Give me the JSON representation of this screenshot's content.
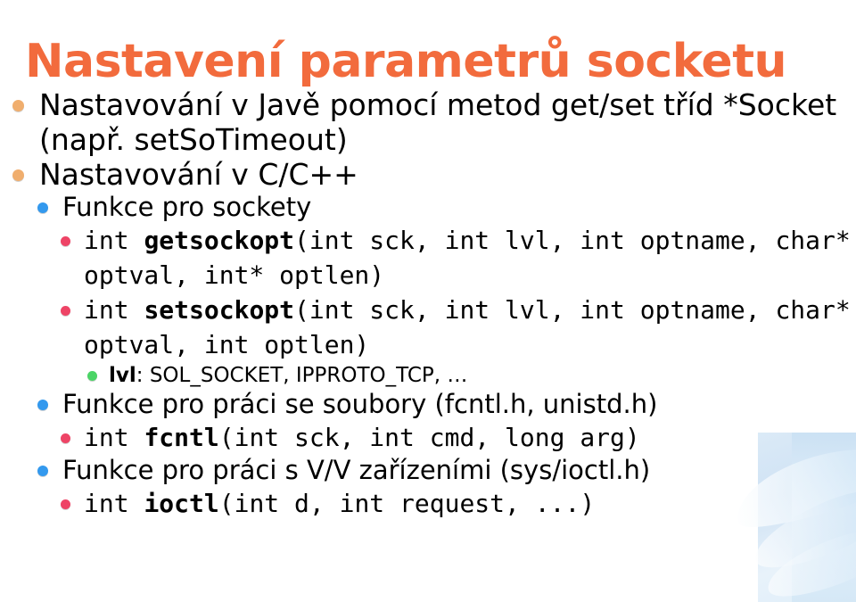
{
  "slide": {
    "title": "Nastavení parametrů socketu",
    "title_color": "#F26B3D",
    "background_color": "#FFFFFF",
    "text_color": "#000000"
  },
  "bullet_colors": {
    "level1": "#F0AE6E",
    "level2": "#3399EE",
    "level3": "#EE4466",
    "level4": "#4BD466"
  },
  "outline": {
    "item1": {
      "level": 1,
      "text": "Nastavování v Javě pomocí metod get/set tříd *Socket (např. setSoTimeout)"
    },
    "item2": {
      "level": 1,
      "text": "Nastavování v C/C++"
    },
    "item3": {
      "level": 2,
      "text": "Funkce pro sockety"
    },
    "item4": {
      "level": 3,
      "prefix": "int ",
      "name": "getsockopt",
      "suffix": "(int sck, int lvl, int optname, char* optval, int* optlen)"
    },
    "item5": {
      "level": 3,
      "prefix": "int ",
      "name": "setsockopt",
      "suffix": "(int sck, int lvl, int optname, char* optval, int optlen)"
    },
    "item6": {
      "level": 4,
      "name": "lvl",
      "text": ": SOL_SOCKET, IPPROTO_TCP, …"
    },
    "item7": {
      "level": 2,
      "text": "Funkce pro práci se soubory (fcntl.h, unistd.h)"
    },
    "item8": {
      "level": 3,
      "prefix": "int ",
      "name": "fcntl",
      "suffix": "(int sck, int cmd, long arg)"
    },
    "item9": {
      "level": 2,
      "text": "Funkce pro práci s V/V zařízeními (sys/ioctl.h)"
    },
    "item10": {
      "level": 3,
      "prefix": "int ",
      "name": "ioctl",
      "suffix": "(int d, int request, ...)"
    }
  }
}
